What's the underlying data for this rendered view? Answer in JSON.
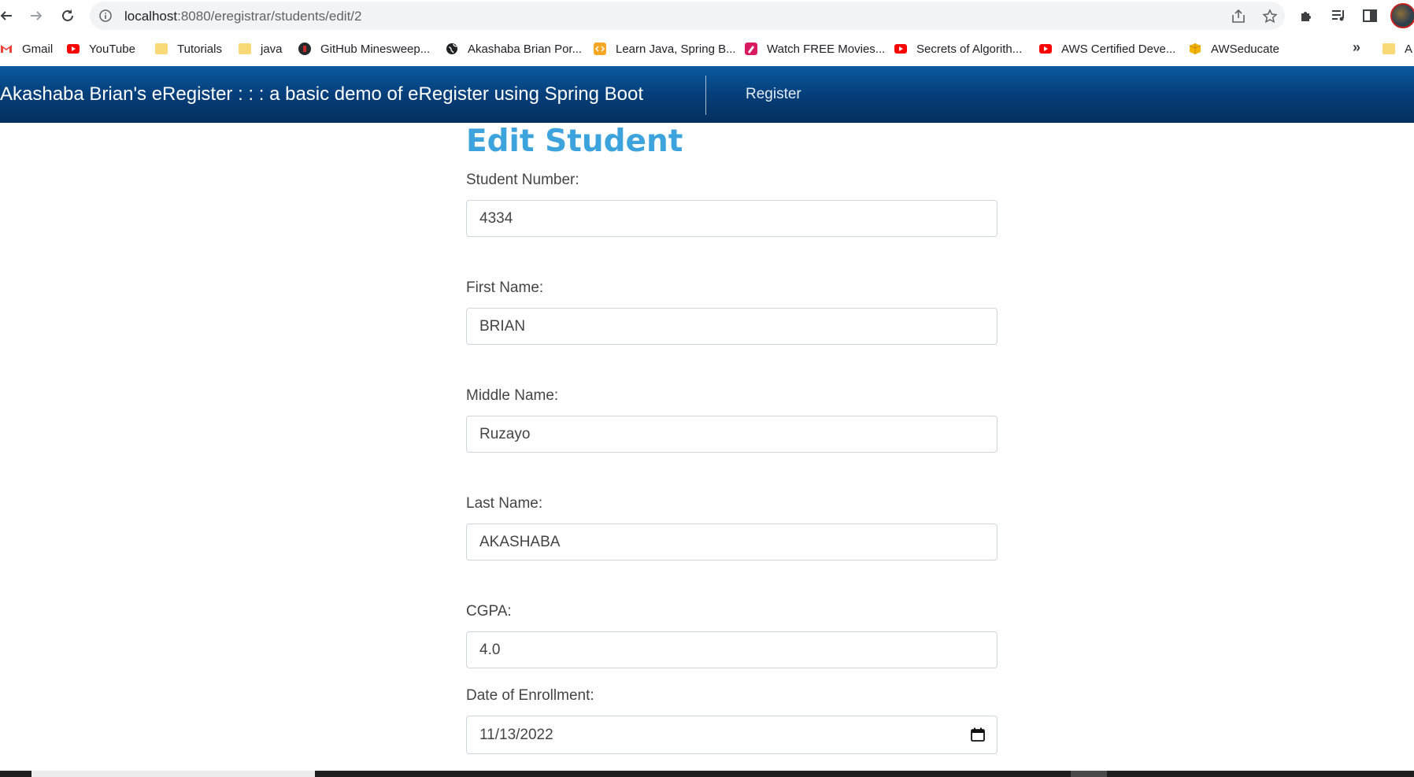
{
  "browser": {
    "url_host": "localhost",
    "url_path": ":8080/eregistrar/students/edit/2"
  },
  "bookmarks": [
    {
      "label": "Gmail",
      "icon": "gmail-icon"
    },
    {
      "label": "YouTube",
      "icon": "youtube-icon"
    },
    {
      "label": "Tutorials",
      "icon": "folder-icon"
    },
    {
      "label": "java",
      "icon": "folder-icon"
    },
    {
      "label": "GitHub Minesweep...",
      "icon": "github-icon"
    },
    {
      "label": "Akashaba Brian Por...",
      "icon": "globe-icon"
    },
    {
      "label": "Learn Java, Spring B...",
      "icon": "code-icon"
    },
    {
      "label": "Watch FREE Movies...",
      "icon": "movie-icon"
    },
    {
      "label": "Secrets of Algorith...",
      "icon": "youtube-icon"
    },
    {
      "label": "AWS Certified Deve...",
      "icon": "youtube-icon"
    },
    {
      "label": "AWSeducate",
      "icon": "aws-icon"
    },
    {
      "label": "A",
      "icon": "folder-icon"
    }
  ],
  "bookmarks_more": "»",
  "navbar": {
    "brand": "Akashaba Brian's eRegister : : : a basic demo of eRegister using Spring Boot",
    "register_link": "Register"
  },
  "form": {
    "title": "Edit Student",
    "student_number": {
      "label": "Student Number:",
      "value": "4334"
    },
    "first_name": {
      "label": "First Name:",
      "value": "BRIAN"
    },
    "middle_name": {
      "label": "Middle Name:",
      "value": "Ruzayo"
    },
    "last_name": {
      "label": "Last Name:",
      "value": "AKASHABA"
    },
    "cgpa": {
      "label": "CGPA:",
      "value": "4.0"
    },
    "date_of_enrollment": {
      "label": "Date of Enrollment:",
      "value": "11/13/2022"
    }
  },
  "colors": {
    "navbar": "#063f7a",
    "title": "#3ca3dc"
  }
}
